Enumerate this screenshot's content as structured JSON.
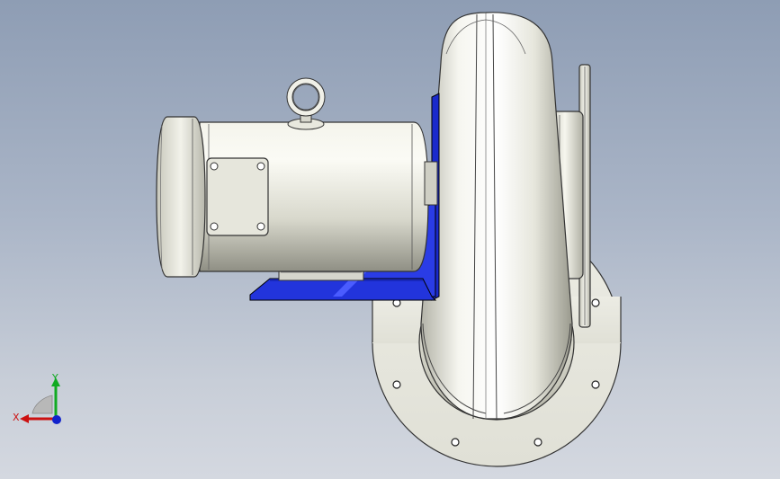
{
  "viewport": {
    "background_top": "#8e9db4",
    "background_bottom": "#d4d8e0"
  },
  "model": {
    "parts": [
      "motor",
      "eye-bolt",
      "motor-bracket",
      "blower-scroll-housing",
      "outlet-flange",
      "inlet-flange"
    ],
    "bracket_color": "#2233dd",
    "metal_color": "#e8e8dc"
  },
  "triad": {
    "x_label": "X",
    "y_label": "Y",
    "x_color": "#cc1111",
    "y_color": "#11aa22",
    "z_color": "#1122cc"
  }
}
